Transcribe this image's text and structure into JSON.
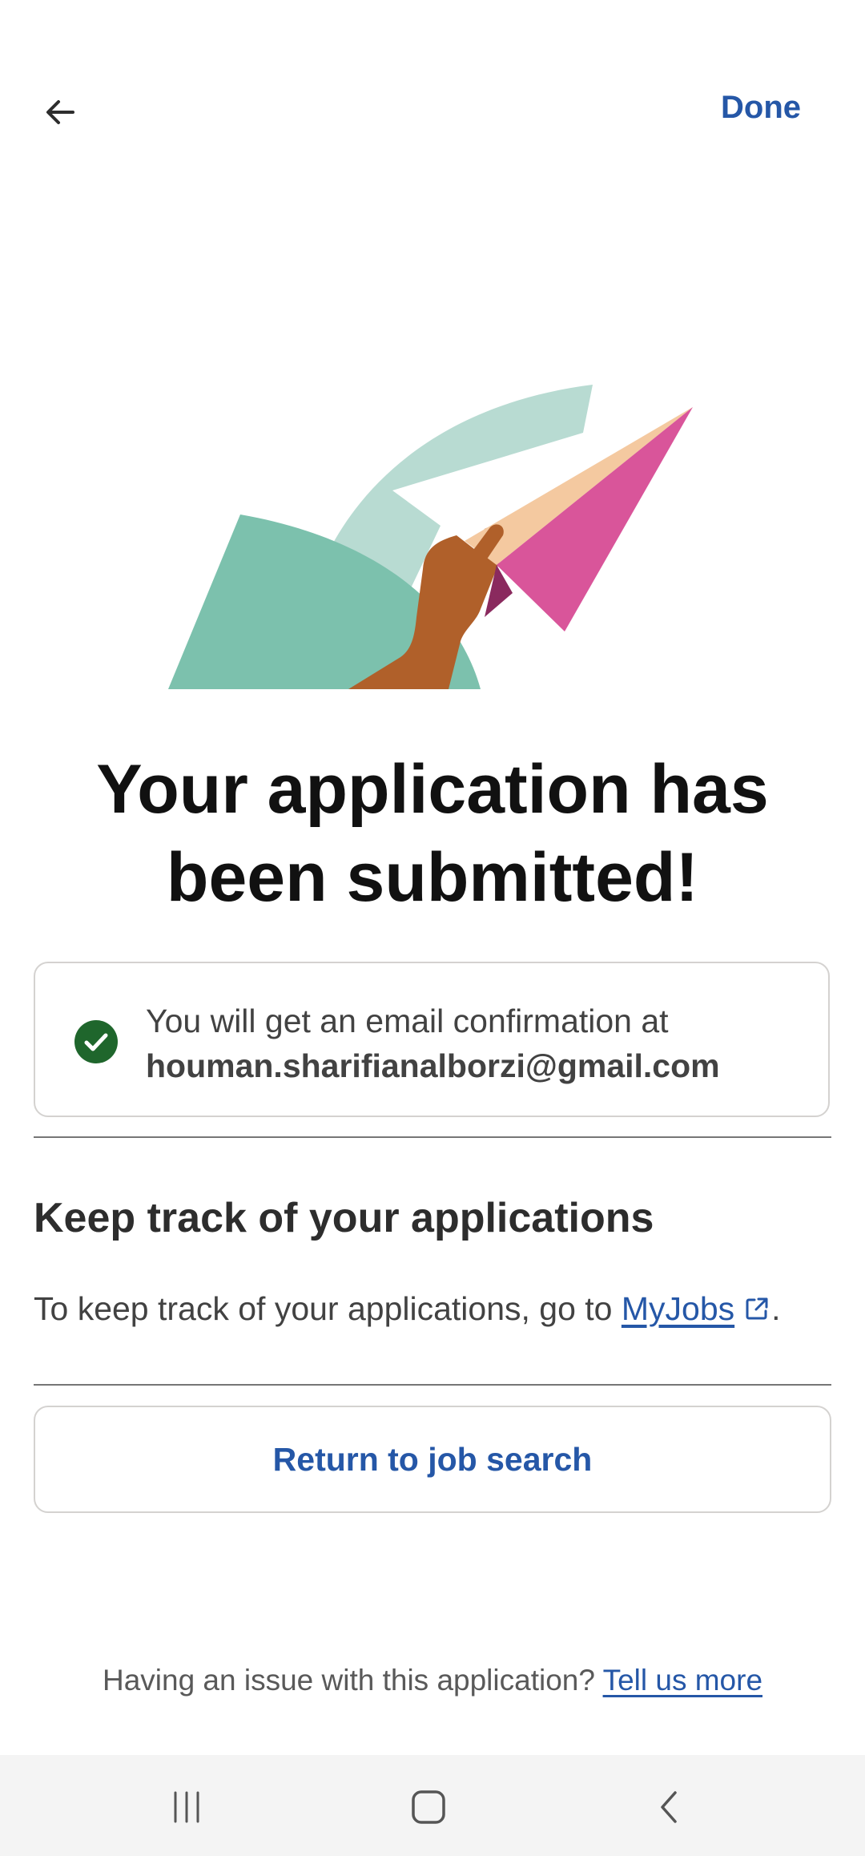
{
  "header": {
    "back_label": "back",
    "done_label": "Done"
  },
  "main": {
    "title": "Your application has been submitted!",
    "confirmation": {
      "text": "You will get an email confirmation at",
      "email": "houman.sharifianalborzi@gmail.com"
    },
    "tracking": {
      "heading": "Keep track of your applications",
      "text_prefix": "To keep track of your applications, go to",
      "link_label": "MyJobs",
      "text_suffix": "."
    },
    "return_button_label": "Return to job search",
    "issue": {
      "text": "Having an issue with this application?",
      "link_label": "Tell us more"
    }
  },
  "colors": {
    "brand_blue": "#2557a7",
    "success_green": "#1f662c",
    "navbar_bg": "#f4f4f4"
  },
  "icons": {
    "back": "arrow-left-icon",
    "success": "check-circle-icon",
    "external": "external-link-icon",
    "nav_recents": "recents-icon",
    "nav_home": "home-icon",
    "nav_back": "chevron-left-icon"
  }
}
